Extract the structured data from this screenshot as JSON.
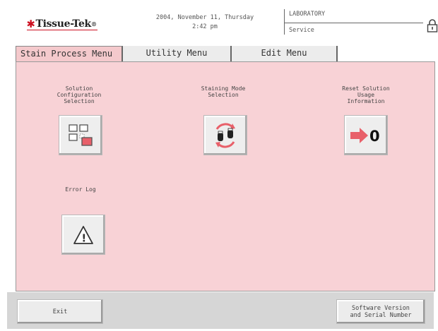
{
  "header": {
    "logo_text": "Tissue-Tek",
    "logo_mark": "®",
    "date": "2004, November 11, Thursday",
    "time": "2:42 pm",
    "location": "LABORATORY",
    "mode": "Service",
    "lock_icon": "lock-icon"
  },
  "tabs": [
    {
      "label": "Stain Process Menu",
      "active": true
    },
    {
      "label": "Utility Menu",
      "active": false
    },
    {
      "label": "Edit Menu",
      "active": false
    }
  ],
  "functions": {
    "solution_config": {
      "label": "Solution\nConfiguration\nSelection",
      "icon": "grid-config-icon"
    },
    "staining_mode": {
      "label": "Staining Mode\nSelection",
      "icon": "swap-slides-icon"
    },
    "reset_solution": {
      "label": "Reset Solution\nUsage\nInformation",
      "icon": "arrow-to-zero-icon",
      "icon_text": "0"
    },
    "error_log": {
      "label": "Error Log",
      "icon": "warning-icon",
      "icon_text": "!"
    }
  },
  "bottom": {
    "exit_label": "Exit",
    "software_label": "Software Version\nand Serial Number"
  },
  "colors": {
    "main_bg": "#f8d2d6",
    "accent_red": "#cc1020",
    "arrow_red": "#e8606a"
  }
}
